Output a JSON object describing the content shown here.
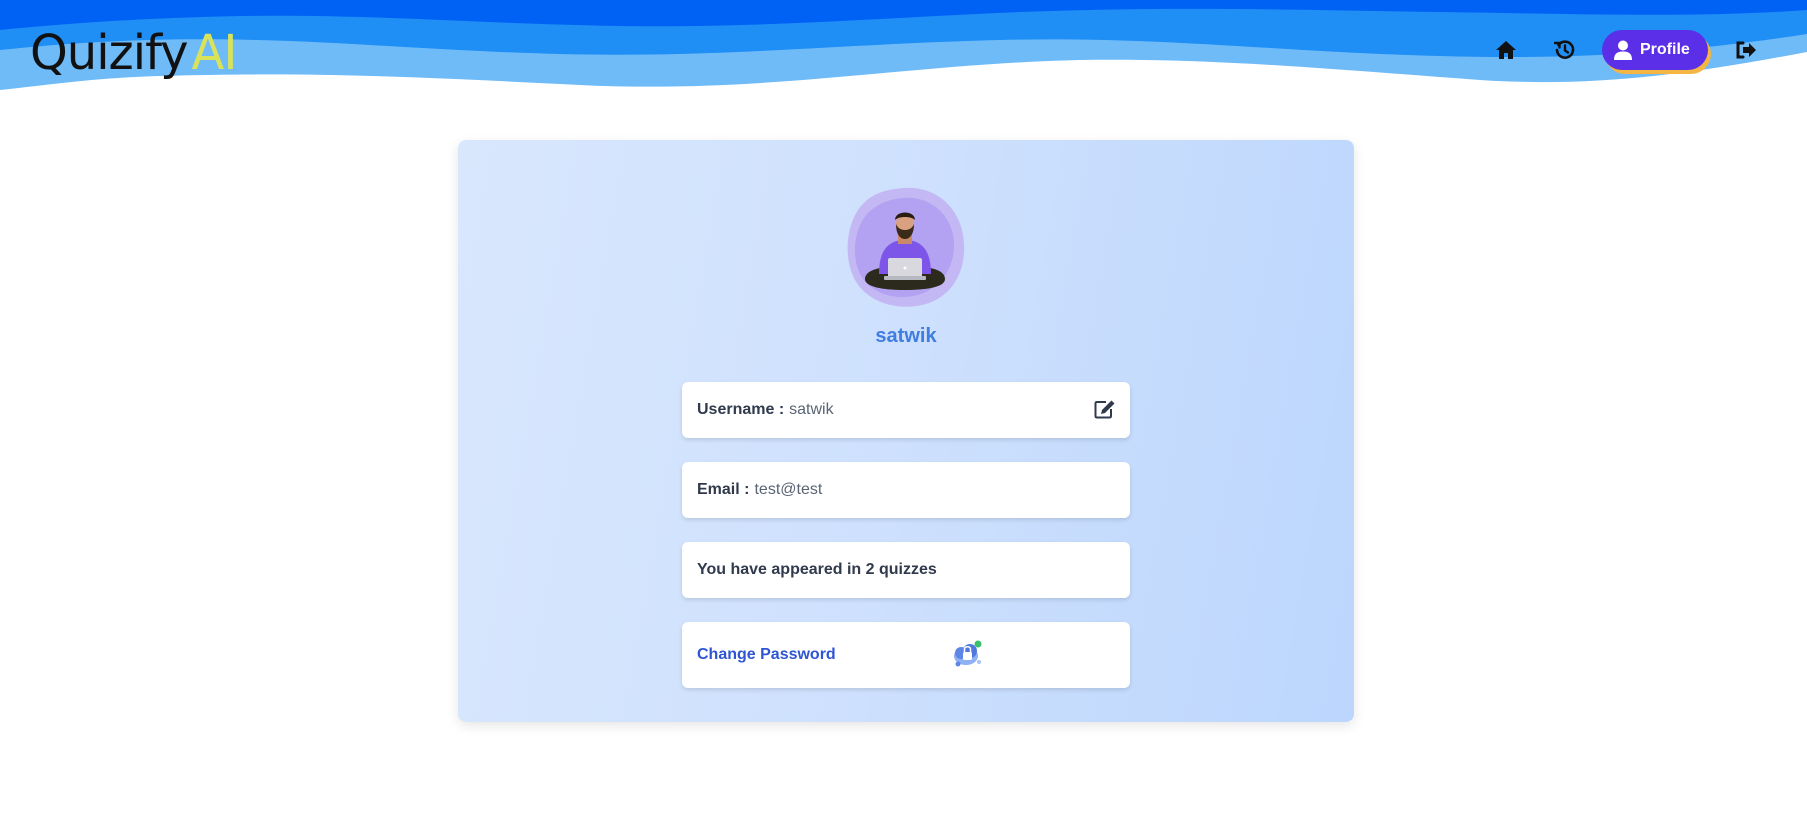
{
  "header": {
    "logo_main": "Quizify",
    "logo_accent": "AI",
    "nav": {
      "home_icon": "home-icon",
      "history_icon": "history-icon",
      "profile_label": "Profile",
      "profile_icon": "user-icon",
      "logout_icon": "logout-icon"
    }
  },
  "profile": {
    "avatar_icon": "person-with-laptop-illustration",
    "display_name": "satwik",
    "username_label": "Username :",
    "username_value": "satwik",
    "edit_icon": "edit-icon",
    "email_label": "Email :",
    "email_value": "test@test",
    "quizzes_text": "You have appeared in 2 quizzes",
    "change_password_label": "Change Password",
    "change_password_image": "lock-cloud-illustration"
  },
  "colors": {
    "wave_dark": "#0062f5",
    "wave_mid": "#1f8ef5",
    "wave_light": "#6fbbf8",
    "profile_button": "#5b2ee8",
    "profile_button_shadow": "#f5b542",
    "logo_accent": "#d9e35a",
    "display_name": "#3f7de0",
    "link": "#2f55d4"
  }
}
